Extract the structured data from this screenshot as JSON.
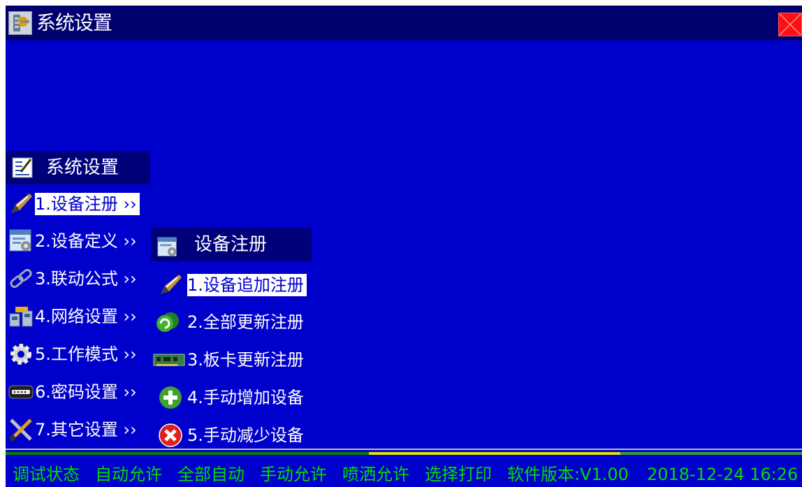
{
  "window": {
    "title": "系统设置",
    "close_icon": "close-icon",
    "accent_color": "#0000cc",
    "close_color": "#ff1010"
  },
  "main_menu": {
    "header": "系统设置",
    "header_icon": "settings-notepad-icon",
    "items": [
      {
        "label": "1.设备注册 ››",
        "icon": "pencil-icon",
        "selected": true
      },
      {
        "label": "2.设备定义 ››",
        "icon": "form-gear-icon",
        "selected": false
      },
      {
        "label": "3.联动公式 ››",
        "icon": "chain-link-icon",
        "selected": false
      },
      {
        "label": "4.网络设置 ››",
        "icon": "network-icon",
        "selected": false
      },
      {
        "label": "5.工作模式 ››",
        "icon": "gear-icon",
        "selected": false
      },
      {
        "label": "6.密码设置 ››",
        "icon": "password-icon",
        "selected": false
      },
      {
        "label": "7.其它设置 ››",
        "icon": "tools-icon",
        "selected": false
      }
    ]
  },
  "sub_menu": {
    "header": "设备注册",
    "header_icon": "form-gear-icon",
    "items": [
      {
        "label": "1.设备追加注册",
        "icon": "pencil-icon",
        "selected": true
      },
      {
        "label": "2.全部更新注册",
        "icon": "refresh-icon",
        "selected": false
      },
      {
        "label": "3.板卡更新注册",
        "icon": "circuit-board-icon",
        "selected": false
      },
      {
        "label": "4.手动增加设备",
        "icon": "add-icon",
        "selected": false
      },
      {
        "label": "5.手动减少设备",
        "icon": "remove-icon",
        "selected": false
      }
    ]
  },
  "status_bar": {
    "items": [
      "调试状态",
      "自动允许",
      "全部自动",
      "手动允许",
      "喷洒允许",
      "选择打印",
      "软件版本:V1.00"
    ],
    "datetime": "2018-12-24 16:26",
    "text_color": "#00dd00"
  }
}
